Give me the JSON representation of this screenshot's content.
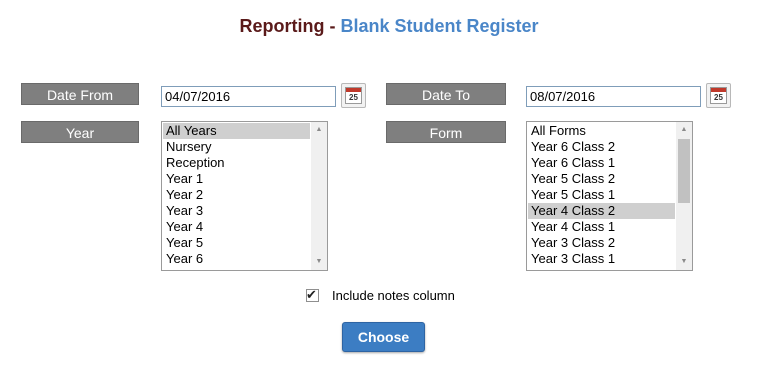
{
  "header": {
    "prefix": "Reporting",
    "separator": " - ",
    "report_name": "Blank Student Register"
  },
  "date_from": {
    "label": "Date From",
    "value": "04/07/2016",
    "calendar_icon": "calendar-icon",
    "calendar_day": "25"
  },
  "date_to": {
    "label": "Date To",
    "value": "08/07/2016",
    "calendar_icon": "calendar-icon",
    "calendar_day": "25"
  },
  "year": {
    "label": "Year",
    "options": [
      "All Years",
      "Nursery",
      "Reception",
      "Year 1",
      "Year 2",
      "Year 3",
      "Year 4",
      "Year 5",
      "Year 6"
    ],
    "selected": "All Years"
  },
  "form": {
    "label": "Form",
    "options": [
      "All Forms",
      "Year 6 Class 2",
      "Year 6 Class 1",
      "Year 5 Class 2",
      "Year 5 Class 1",
      "Year 4 Class 2",
      "Year 4 Class 1",
      "Year 3 Class 2",
      "Year 3 Class 1"
    ],
    "selected": "Year 4 Class 2"
  },
  "include_notes": {
    "label": "Include notes column",
    "checked": true
  },
  "choose_button": {
    "label": "Choose"
  },
  "colors": {
    "title_prefix": "#5a1a1a",
    "title_name": "#4a86c8",
    "label_bg": "#7f7f7f",
    "button_bg": "#3c7dc3"
  }
}
